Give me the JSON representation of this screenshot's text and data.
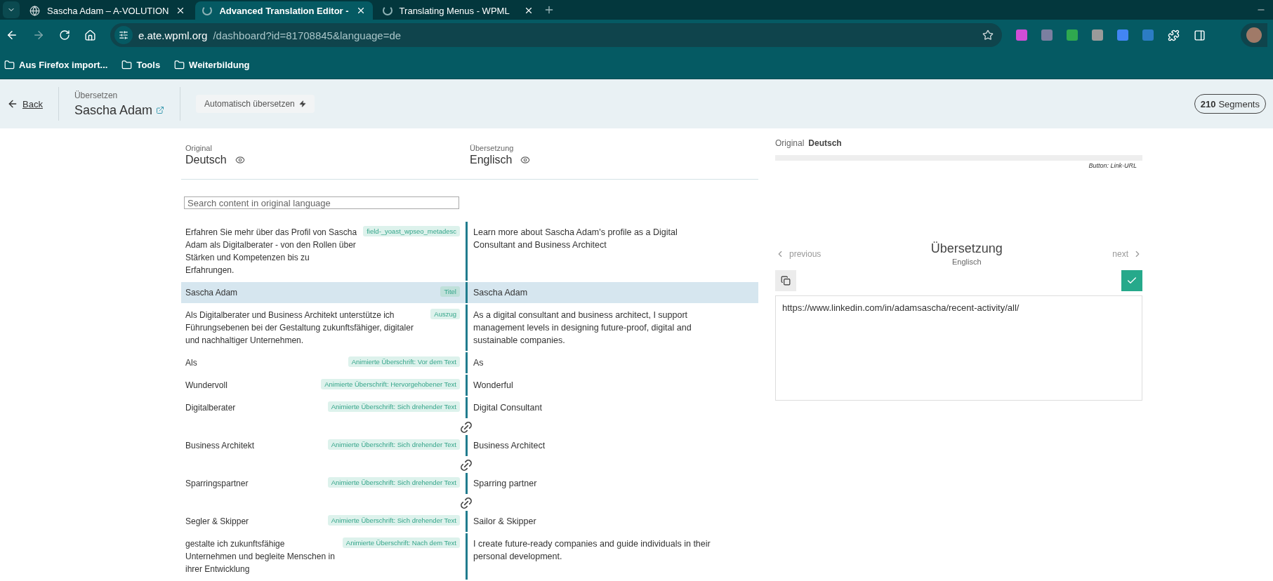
{
  "browser": {
    "tabs": [
      {
        "title": "Sascha Adam – A-VOLUTION",
        "selected": false
      },
      {
        "title": "Advanced Translation Editor -",
        "selected": true
      },
      {
        "title": "Translating Menus - WPML",
        "selected": false
      }
    ],
    "address": {
      "host": "e.ate.wpml.org",
      "path": "/dashboard?id=81708845&language=de"
    },
    "bookmarks": [
      "Aus Firefox import...",
      "Tools",
      "Weiterbildung"
    ]
  },
  "header": {
    "back": "Back",
    "subtitle": "Übersetzen",
    "title": "Sascha Adam",
    "auto_translate": "Automatisch übersetzen",
    "segment_count": "210",
    "segment_label": "Segments"
  },
  "columns": [
    {
      "label": "Original",
      "language": "Deutsch"
    },
    {
      "label": "Übersetzung",
      "language": "Englisch"
    }
  ],
  "search": {
    "placeholder": "Search content in original language"
  },
  "segments": [
    {
      "kind": "segment",
      "source": "Erfahren Sie mehr über das Profil von Sascha Adam als Digitalberater - von den Rollen über Stärken und Kompetenzen bis zu Erfahrungen.",
      "tag": "field-_yoast_wpseo_metadesc",
      "target": "Learn more about Sascha Adam's profile as a Digital Consultant and Business Architect",
      "selected": false
    },
    {
      "kind": "segment",
      "source": "Sascha Adam",
      "tag": "Titel",
      "target": "Sascha Adam",
      "selected": true
    },
    {
      "kind": "segment",
      "source": "Als Digitalberater und Business Architekt unterstütze ich Führungsebenen bei der Gestaltung zukunftsfähiger, digitaler und nachhaltiger Unternehmen.",
      "tag": "Auszug",
      "target": "As a digital consultant and business architect, I support management levels in designing future-proof, digital and sustainable companies.",
      "selected": false
    },
    {
      "kind": "segment",
      "source": "Als",
      "tag": "Animierte Überschrift: Vor dem Text",
      "target": "As",
      "selected": false
    },
    {
      "kind": "segment",
      "source": "Wundervoll",
      "tag": "Animierte Überschrift: Hervorgehobener Text",
      "target": "Wonderful",
      "selected": false
    },
    {
      "kind": "segment",
      "source": "Digitalberater",
      "tag": "Animierte Überschrift: Sich drehender Text",
      "target": "Digital Consultant",
      "selected": false
    },
    {
      "kind": "link"
    },
    {
      "kind": "segment",
      "source": "Business Architekt",
      "tag": "Animierte Überschrift: Sich drehender Text",
      "target": "Business Architect",
      "selected": false
    },
    {
      "kind": "link"
    },
    {
      "kind": "segment",
      "source": "Sparringspartner",
      "tag": "Animierte Überschrift: Sich drehender Text",
      "target": "Sparring partner",
      "selected": false
    },
    {
      "kind": "link"
    },
    {
      "kind": "segment",
      "source": "Segler & Skipper",
      "tag": "Animierte Überschrift: Sich drehender Text",
      "target": "Sailor & Skipper",
      "selected": false
    },
    {
      "kind": "segment",
      "source": "gestalte ich zukunftsfähige Unternehmen und begleite Menschen in ihrer Entwicklung",
      "tag": "Animierte Überschrift: Nach dem Text",
      "target": "I create future-ready companies and guide individuals in their personal development.",
      "selected": false
    }
  ],
  "panel": {
    "original_label": "Original",
    "original_language": "Deutsch",
    "field_label": "Button: Link-URL",
    "previous": "previous",
    "next": "next",
    "title": "Übersetzung",
    "language": "Englisch",
    "value": "https://www.linkedin.com/in/adamsascha/recent-activity/all/"
  }
}
